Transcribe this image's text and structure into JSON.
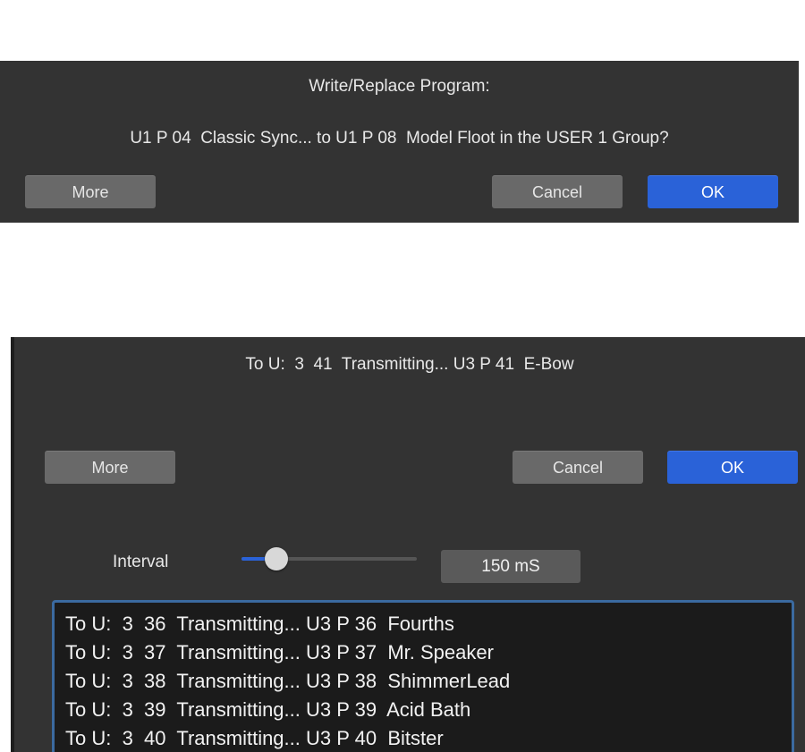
{
  "write_dialog": {
    "title": "Write/Replace Program:",
    "message": "U1 P 04  Classic Sync... to U1 P 08  Model Floot in the USER 1 Group?",
    "more_label": "More",
    "cancel_label": "Cancel",
    "ok_label": "OK"
  },
  "transmit_dialog": {
    "status": "To U:  3  41  Transmitting... U3 P 41  E-Bow",
    "more_label": "More",
    "cancel_label": "Cancel",
    "ok_label": "OK",
    "interval": {
      "label": "Interval",
      "value_text": "150 mS",
      "slider_fraction": 0.2
    },
    "log_lines": [
      "To U:  3  36  Transmitting... U3 P 36  Fourths",
      "To U:  3  37  Transmitting... U3 P 37  Mr. Speaker",
      "To U:  3  38  Transmitting... U3 P 38  ShimmerLead",
      "To U:  3  39  Transmitting... U3 P 39  Acid Bath",
      "To U:  3  40  Transmitting... U3 P 40  Bitster"
    ]
  },
  "colors": {
    "dialog_bg": "#333333",
    "button_grey": "#696969",
    "button_blue": "#2a62d8",
    "log_bg": "#1b1b1b",
    "log_border": "#3b6aa0"
  }
}
